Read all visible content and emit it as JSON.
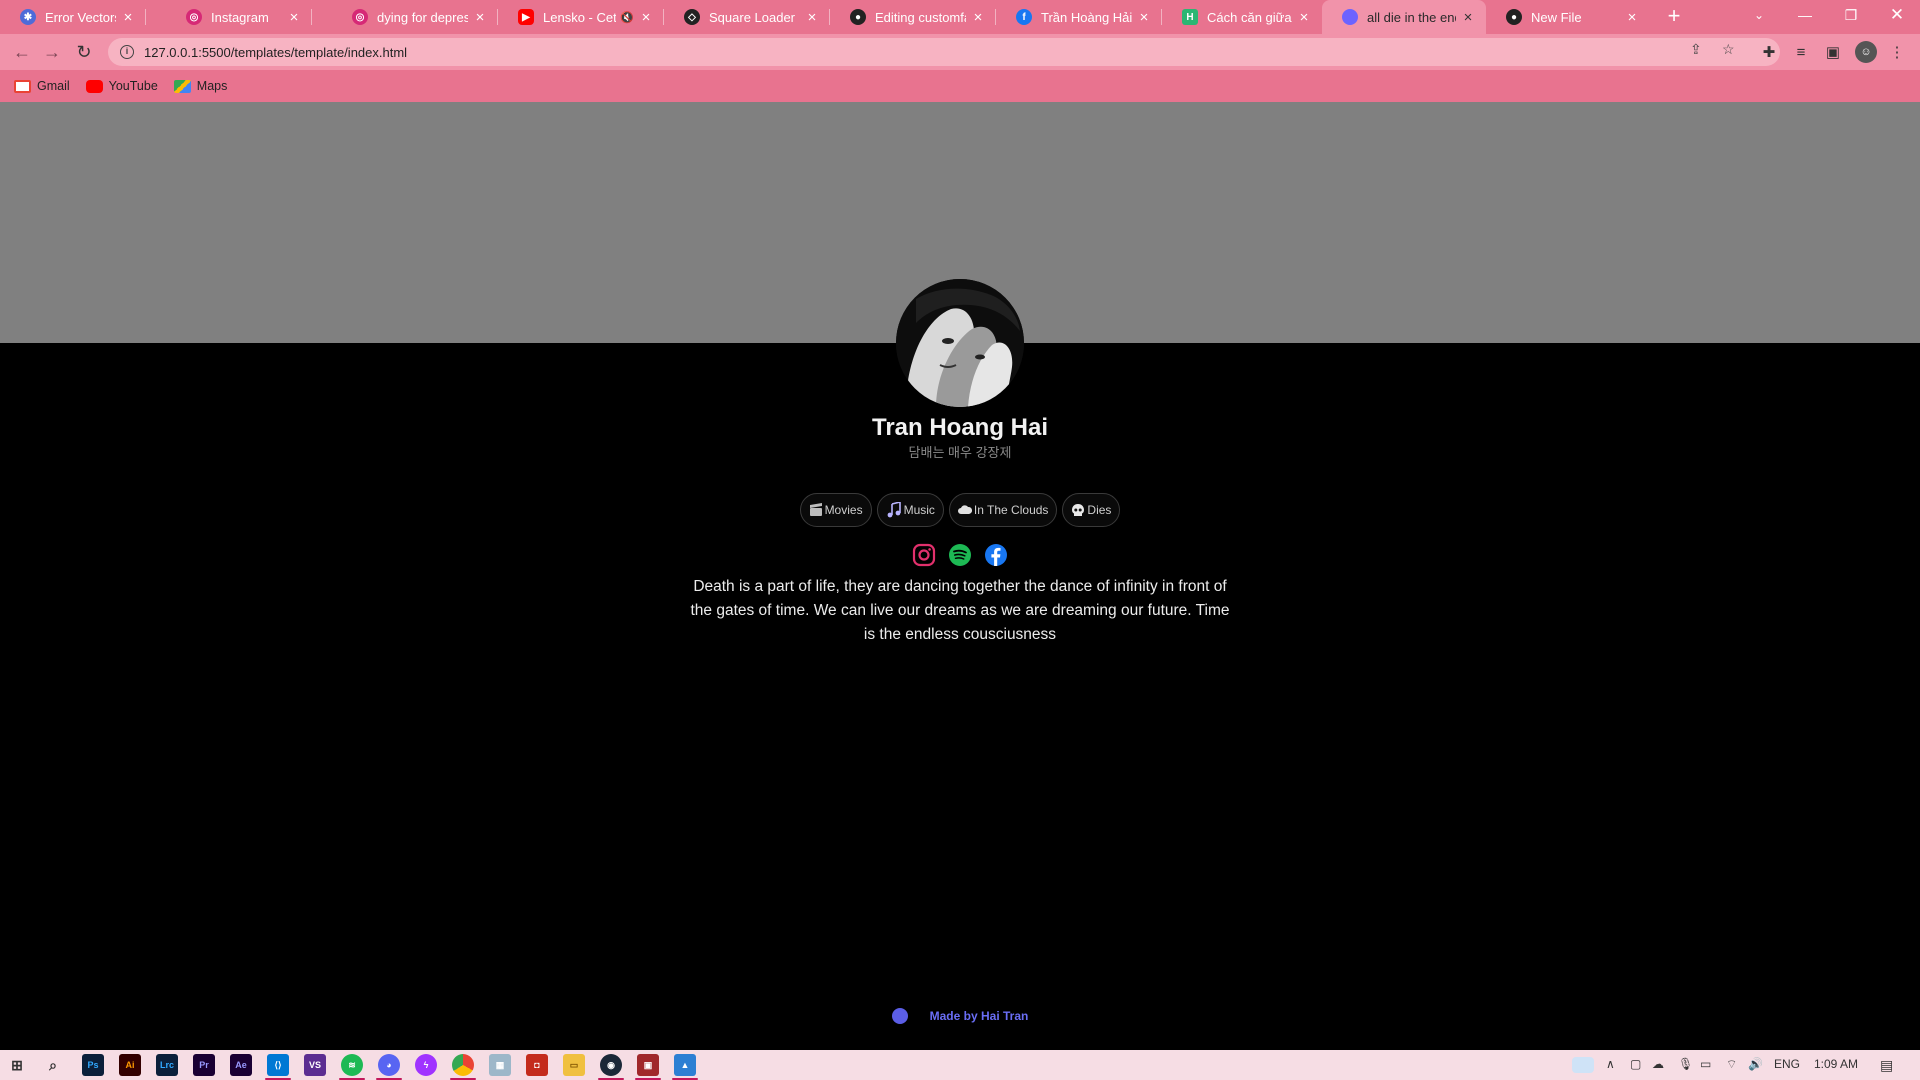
{
  "browser": {
    "tabs": [
      {
        "title": "Error Vectors, Photos",
        "favicon": "vector-site-icon",
        "color": "#4f6bd8"
      },
      {
        "title": "Instagram",
        "favicon": "instagram-icon",
        "color": "#d62976"
      },
      {
        "title": "dying for depression",
        "favicon": "instagram-icon",
        "color": "#d62976"
      },
      {
        "title": "Lensko - Cetus",
        "favicon": "youtube-icon",
        "color": "#ff0000",
        "muted": true
      },
      {
        "title": "Square Loader",
        "favicon": "codepen-icon",
        "color": "#222222"
      },
      {
        "title": "Editing customface",
        "favicon": "github-icon",
        "color": "#222222"
      },
      {
        "title": "Trần Hoàng Hải | F",
        "favicon": "facebook-icon",
        "color": "#1877f2"
      },
      {
        "title": "Cách căn giữa ảnh",
        "favicon": "site-icon",
        "color": "#2bb673"
      },
      {
        "title": "all die in the end",
        "favicon": "page-dot-icon",
        "color": "#6c63ff",
        "active": true
      },
      {
        "title": "New File",
        "favicon": "github-icon",
        "color": "#222222"
      }
    ],
    "url": "127.0.0.1:5500/templates/template/index.html",
    "bookmarks": [
      {
        "label": "Gmail",
        "icon": "gmail-icon"
      },
      {
        "label": "YouTube",
        "icon": "youtube-icon"
      },
      {
        "label": "Maps",
        "icon": "maps-icon"
      }
    ]
  },
  "profile": {
    "name": "Tran Hoang Hai",
    "subtitle": "담배는 매우 강장제",
    "tags": [
      {
        "label": "Movies",
        "icon": "clapperboard-icon"
      },
      {
        "label": "Music",
        "icon": "music-note-icon"
      },
      {
        "label": "In The Clouds",
        "icon": "cloud-icon"
      },
      {
        "label": "Dies",
        "icon": "skull-icon"
      }
    ],
    "socials": [
      "instagram-icon",
      "spotify-icon",
      "facebook-icon"
    ],
    "quote": "Death is a part of life, they are dancing together the dance of infinity in front of the gates of time. We can live our dreams as we are dreaming our future. Time is the endless cousciusness",
    "credit": "Made by Hai Tran"
  },
  "colors": {
    "chrome_pink": "#e8738f",
    "banner_gray": "#808080",
    "page_bg": "#000000",
    "credit_accent": "#6a6ef5"
  },
  "taskbar": {
    "language": "ENG",
    "time": "1:09 AM"
  }
}
